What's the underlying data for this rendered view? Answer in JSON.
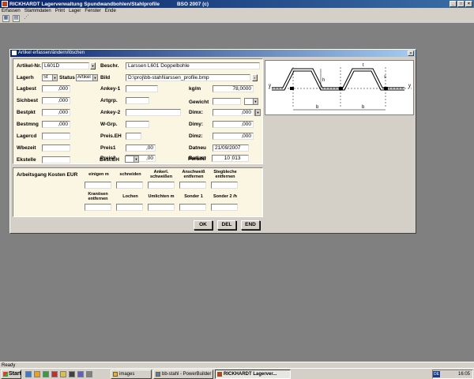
{
  "window": {
    "title": "RICKHARDT Lagerverwaltung Spundwandbohlen/Stahlprofile",
    "version": "BSO 2007 (c)"
  },
  "menu": [
    "Erfassen",
    "Stammdaten",
    "Print",
    "Lager",
    "Fenster",
    "Ende"
  ],
  "dialog": {
    "title": "Artikel erfassen/ändern/löschen",
    "artikel_nr": {
      "label": "Artikel-Nr.",
      "value": "L601D"
    },
    "beschr": {
      "label": "Beschr.",
      "value": "Larssen L601 Doppelbohle"
    },
    "lagerh": {
      "label": "Lagerh",
      "value": "St"
    },
    "status": {
      "label": "Status",
      "value": "Artikel"
    },
    "bild": {
      "label": "Bild",
      "value": "D:\\proj\\bb-stahl\\larssen_profile.bmp"
    },
    "left_fields": [
      {
        "label": "Lagbest",
        "value": ",000"
      },
      {
        "label": "Sichbest",
        "value": ",000"
      },
      {
        "label": "Bestpkt",
        "value": ",000"
      },
      {
        "label": "Bestmng",
        "value": ",000"
      },
      {
        "label": "Lagercd",
        "value": ""
      },
      {
        "label": "Wbezeit",
        "value": ""
      },
      {
        "label": "Ekstelle",
        "value": ""
      }
    ],
    "mid_fields": [
      {
        "label": "Ankey-1",
        "value": ""
      },
      {
        "label": "Artgrp.",
        "value": ""
      },
      {
        "label": "Ankey-2",
        "value": ""
      },
      {
        "label": "W-Grp.",
        "value": ""
      },
      {
        "label": "Preis.EH",
        "value": ""
      },
      {
        "label": "Preis1",
        "value": ",00"
      },
      {
        "label": "Preis2",
        "value": ",00"
      },
      {
        "label": "Best.EH",
        "value": ""
      }
    ],
    "right_fields": [
      {
        "label": "kg/m",
        "value": "78,0000"
      },
      {
        "label": "Gewicht",
        "value": ""
      },
      {
        "label": "Dimx:",
        "value": ",000"
      },
      {
        "label": "Dimy:",
        "value": ",000"
      },
      {
        "label": "Dimz:",
        "value": ",000"
      },
      {
        "label": "Datneu",
        "value": "21/09/2007"
      },
      {
        "label": "Datlast",
        "value": "25/06/2013"
      },
      {
        "label": "Pers.Nr",
        "value": "10"
      }
    ],
    "costs": {
      "title": "Arbeitsgang Kosten EUR",
      "row1": [
        "einigen m",
        "schneiden",
        "Ankerl. schweißen",
        "Anschweiß entfernen",
        "Stegbleche entfernen"
      ],
      "row2": [
        "Kranösen entfernen",
        "Lochen",
        "Umlichten m",
        "Sonder 1",
        "Sonder 2 /h"
      ]
    },
    "buttons": {
      "ok": "OK",
      "del": "DEL",
      "end": "END"
    }
  },
  "drawing_labels": {
    "y": "y",
    "t": "t",
    "h": "h",
    "b": "b",
    "s": "s"
  },
  "status_text": "Ready",
  "taskbar": {
    "start": "Start",
    "tasks": [
      "images",
      "bb-stahl - PowerBuilder",
      "RICKHARDT Lagerver..."
    ],
    "lang": "DE",
    "clock": "16:05"
  }
}
